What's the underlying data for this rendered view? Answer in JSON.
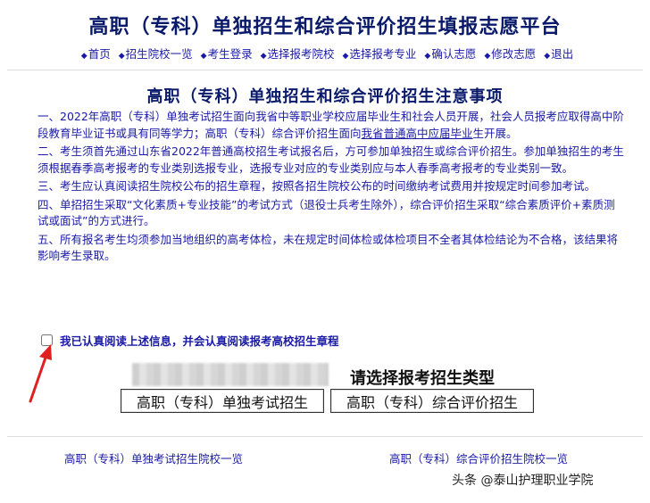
{
  "header": {
    "title": "高职（专科）单独招生和综合评价招生填报志愿平台",
    "nav": [
      "首页",
      "招生院校一览",
      "考生登录",
      "选择报考院校",
      "选择报考专业",
      "确认志愿",
      "修改志愿",
      "退出"
    ]
  },
  "notice": {
    "title": "高职（专科）单独招生和综合评价招生注意事项",
    "item1_a": "一、2022年高职（专科）单独考试招生面向我省中等职业学校应届毕业生和社会人员开展，社会人员报考应取得高中阶段教育毕业证书或具有同等学力；高职（专科）综合评价招生面向",
    "item1_b": "我省普通高中应届毕业",
    "item1_c": "生开展。",
    "item2": "二、考生须首先通过山东省2022年普通高校招生考试报名后，方可参加单独招生或综合评价招生。参加单独招生的考生须根据春季高考报考的专业类别选报专业，选报专业对应的专业类别应与本人春季高考报考的专业类别一致。",
    "item3": "三、考生应认真阅读招生院校公布的招生章程，按照各招生院校公布的时间缴纳考试费用并按规定时间参加考试。",
    "item4": "四、单招招生采取“文化素质+专业技能”的考试方式（退役士兵考生除外），综合评价招生采取“综合素质评价+素质测试或面试”的方式进行。",
    "item5": "五、所有报名考生均须参加当地组织的高考体检，未在规定时间体检或体检项目不全者其体检结论为不合格，该结果将影响考生录取。"
  },
  "agree": {
    "label": "我已认真阅读上述信息，并会认真阅读报考高校招生章程",
    "checked": false
  },
  "select": {
    "title": "请选择报考招生类型",
    "btn_single": "高职（专科）单独考试招生",
    "btn_comprehensive": "高职（专科）综合评价招生"
  },
  "footer": {
    "link_single": "高职（专科）单独考试招生院校一览",
    "link_comprehensive": "高职（专科）综合评价招生院校一览"
  },
  "watermark": "头条 @泰山护理职业学院",
  "colors": {
    "primary": "#1a1aa6",
    "title": "#0a1a6b",
    "arrow": "#e02020"
  },
  "icons": {
    "nav_bullet": "bullet-icon",
    "arrow": "red-arrow-icon"
  }
}
